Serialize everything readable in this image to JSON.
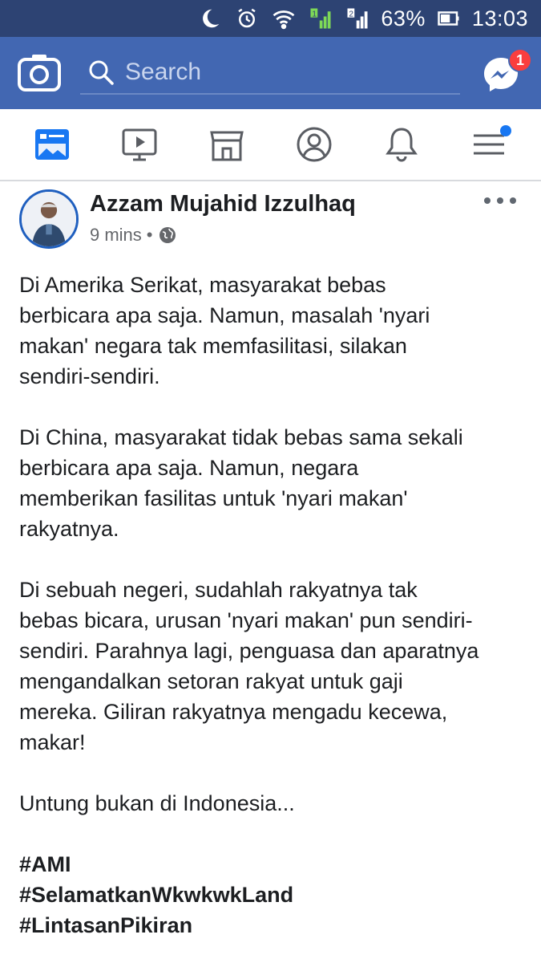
{
  "status_bar": {
    "battery": "63%",
    "time": "13:03",
    "sim1": "1",
    "sim2": "2"
  },
  "top_bar": {
    "search_placeholder": "Search",
    "messenger_badge": "1"
  },
  "nav_tabs": [
    "news-feed",
    "watch",
    "marketplace",
    "profile",
    "notifications",
    "menu"
  ],
  "post": {
    "author": "Azzam Mujahid Izzulhaq",
    "time": "9 mins",
    "separator": "•",
    "paragraphs": [
      "Di Amerika Serikat, masyarakat bebas\nberbicara apa saja. Namun, masalah 'nyari\nmakan' negara tak memfasilitasi, silakan\nsendiri-sendiri.",
      "Di China, masyarakat tidak bebas sama sekali\nberbicara apa saja. Namun, negara\nmemberikan fasilitas untuk 'nyari makan'\nrakyatnya.",
      "Di sebuah negeri, sudahlah rakyatnya tak\nbebas bicara, urusan 'nyari makan' pun sendiri-\nsendiri. Parahnya lagi, penguasa dan aparatnya\nmengandalkan setoran rakyat untuk  gaji\nmereka. Giliran rakyatnya mengadu kecewa,\nmakar!",
      "Untung bukan di Indonesia..."
    ],
    "hashtags": [
      "#AMI",
      "#SelamatkanWkwkwkLand",
      "#LintasanPikiran"
    ]
  },
  "colors": {
    "status_bar": "#2d4373",
    "top_bar": "#4267b2",
    "badge": "#fa3e3e",
    "avatar_ring": "#1f5fbf"
  }
}
